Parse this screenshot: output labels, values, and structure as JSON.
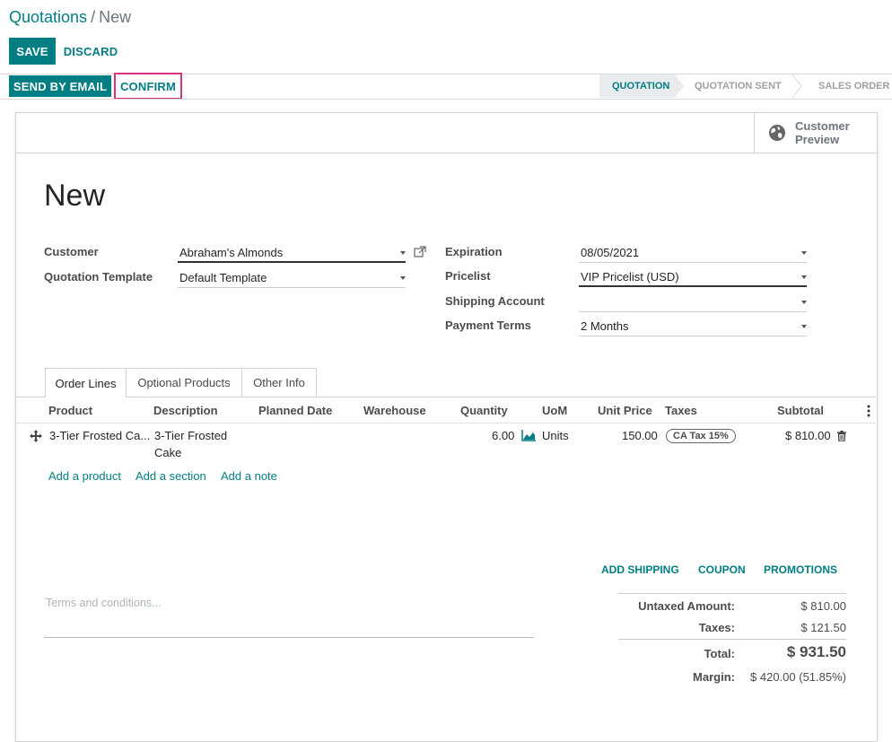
{
  "breadcrumb": {
    "parent": "Quotations",
    "separator": "/",
    "current": "New"
  },
  "actions": {
    "save": "SAVE",
    "discard": "DISCARD",
    "send_email": "SEND BY EMAIL",
    "confirm": "CONFIRM"
  },
  "statusbar": {
    "stages": [
      {
        "label": "QUOTATION",
        "active": true
      },
      {
        "label": "QUOTATION SENT",
        "active": false
      },
      {
        "label": "SALES ORDER",
        "active": false
      }
    ]
  },
  "smart_button": {
    "icon": "globe-icon",
    "line1": "Customer",
    "line2": "Preview"
  },
  "record": {
    "title": "New"
  },
  "fields_left": {
    "customer": {
      "label": "Customer",
      "value": "Abraham's Almonds"
    },
    "template": {
      "label": "Quotation Template",
      "value": "Default Template"
    }
  },
  "fields_right": {
    "expiration": {
      "label": "Expiration",
      "value": "08/05/2021"
    },
    "pricelist": {
      "label": "Pricelist",
      "value": "VIP Pricelist (USD)"
    },
    "shipping": {
      "label": "Shipping Account",
      "value": ""
    },
    "payment_terms": {
      "label": "Payment Terms",
      "value": "2 Months"
    }
  },
  "tabs": [
    "Order Lines",
    "Optional Products",
    "Other Info"
  ],
  "table": {
    "headers": {
      "product": "Product",
      "description": "Description",
      "planned_date": "Planned Date",
      "warehouse": "Warehouse",
      "quantity": "Quantity",
      "uom": "UoM",
      "unit_price": "Unit Price",
      "taxes": "Taxes",
      "subtotal": "Subtotal"
    },
    "rows": [
      {
        "product": "3-Tier Frosted Ca...",
        "description_line1": "3-Tier Frosted",
        "description_line2": "Cake",
        "quantity": "6.00",
        "uom": "Units",
        "unit_price": "150.00",
        "tax": "CA Tax 15%",
        "subtotal": "$ 810.00"
      }
    ],
    "add_links": {
      "product": "Add a product",
      "section": "Add a section",
      "note": "Add a note"
    }
  },
  "order_buttons": {
    "shipping": "ADD SHIPPING",
    "coupon": "COUPON",
    "promotions": "PROMOTIONS"
  },
  "terms": {
    "placeholder": "Terms and conditions..."
  },
  "totals": {
    "untaxed_label": "Untaxed Amount:",
    "untaxed": "$ 810.00",
    "taxes_label": "Taxes:",
    "taxes": "$ 121.50",
    "total_label": "Total:",
    "total": "$ 931.50",
    "margin_label": "Margin:",
    "margin": "$ 420.00 (51.85%)"
  },
  "colors": {
    "accent": "#017e84",
    "confirm_highlight": "#d63384"
  }
}
